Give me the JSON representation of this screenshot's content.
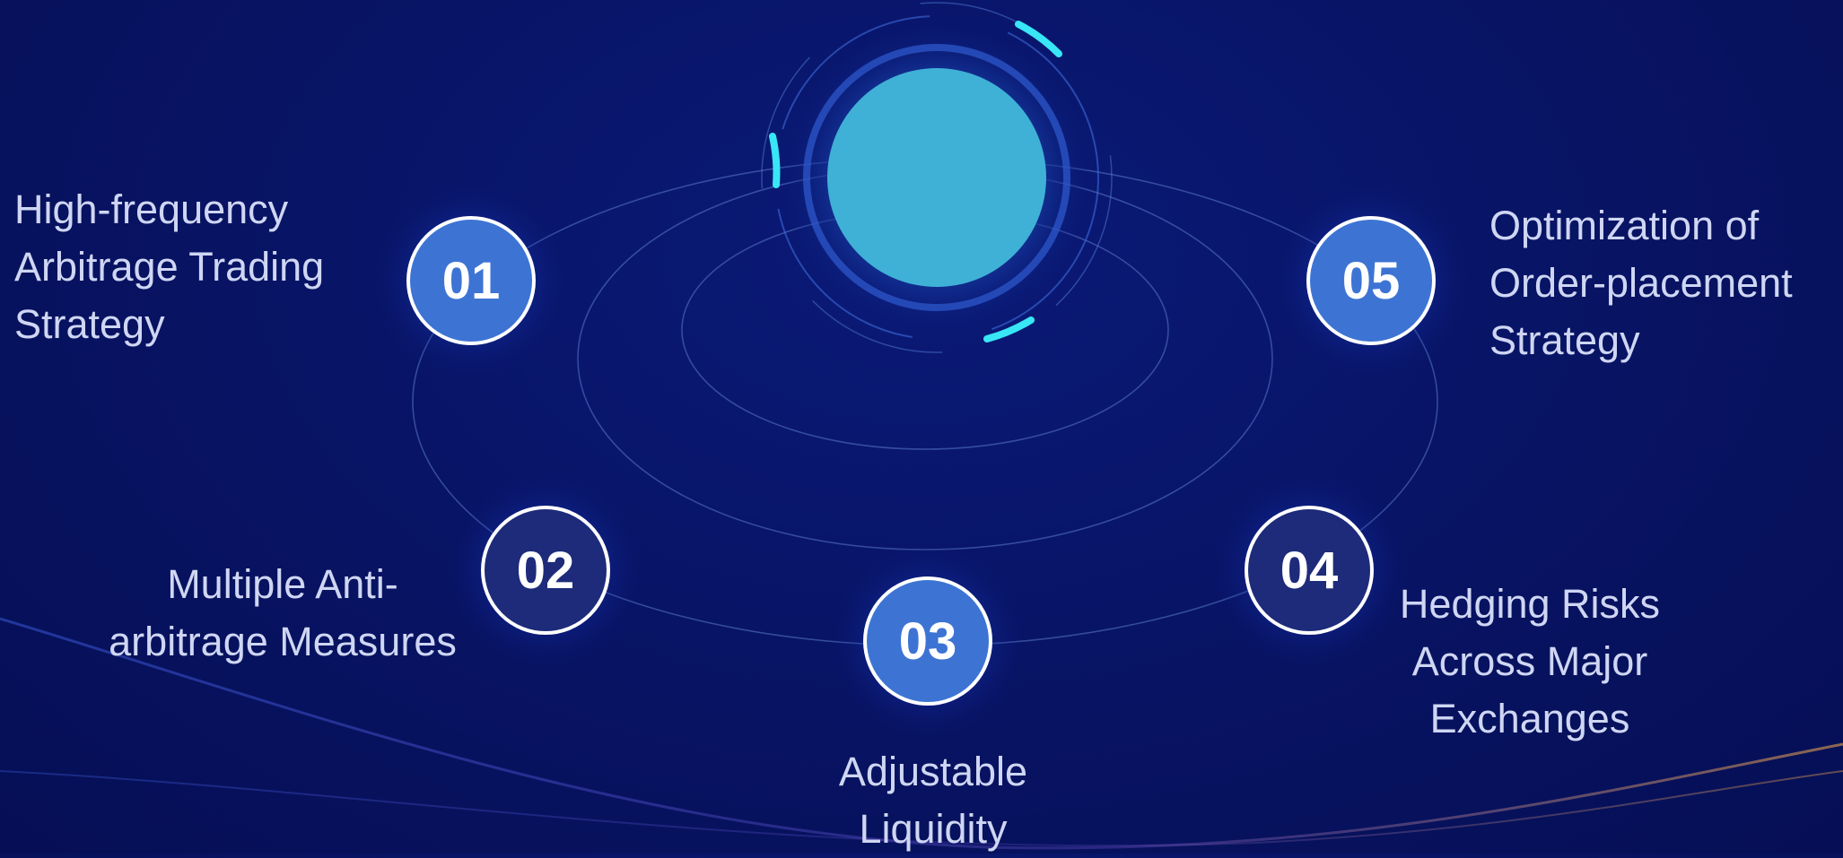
{
  "colors": {
    "background": "#081466",
    "orbit": "#5a78c8",
    "node_light": "#3d74d4",
    "node_dark": "#1d2b7a",
    "center": "#3fb1d6",
    "accent": "#38e6f5",
    "text": "#cfd6f3"
  },
  "nodes": [
    {
      "number": "01",
      "style": "light",
      "label": [
        "High-frequency",
        "Arbitrage Trading",
        "Strategy"
      ]
    },
    {
      "number": "02",
      "style": "dark",
      "label": [
        "Multiple Anti-",
        "arbitrage Measures"
      ]
    },
    {
      "number": "03",
      "style": "light",
      "label": [
        "Adjustable",
        "Liquidity"
      ]
    },
    {
      "number": "04",
      "style": "dark",
      "label": [
        "Hedging Risks",
        "Across Major",
        "Exchanges"
      ]
    },
    {
      "number": "05",
      "style": "light",
      "label": [
        "Optimization of",
        "Order-placement",
        "Strategy"
      ]
    }
  ]
}
